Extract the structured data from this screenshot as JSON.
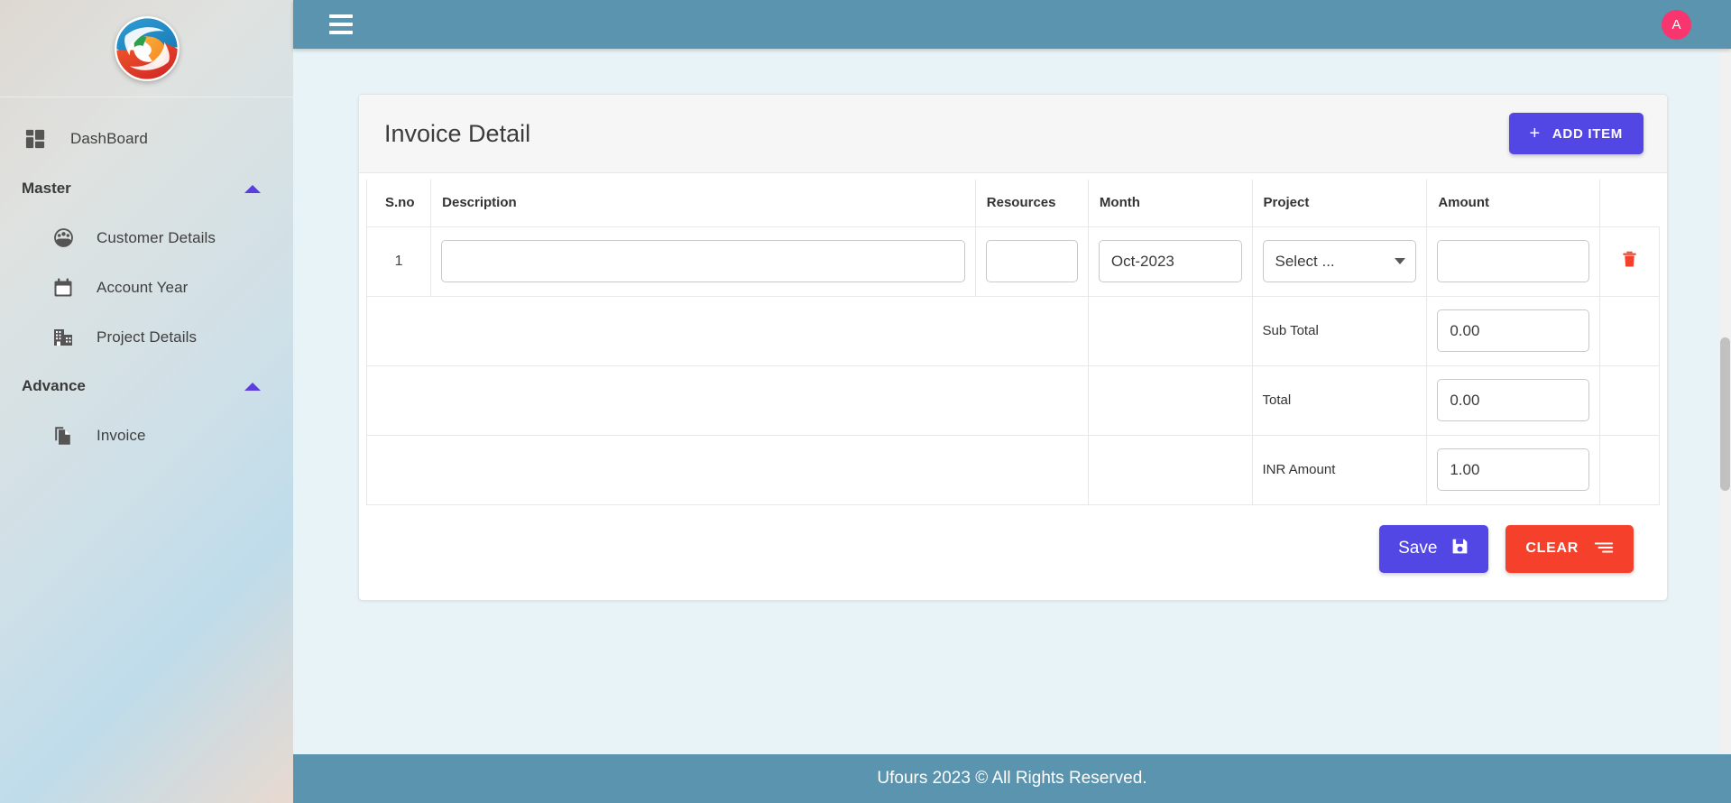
{
  "sidebar": {
    "logo_name": "ufours-logo",
    "dashboard": {
      "label": "DashBoard",
      "icon": "dashboard-grid-icon"
    },
    "groups": [
      {
        "label": "Master",
        "caret": "chevron-up-icon",
        "items": [
          {
            "label": "Customer Details",
            "icon": "people-group-icon"
          },
          {
            "label": "Account Year",
            "icon": "calendar-icon"
          },
          {
            "label": "Project Details",
            "icon": "building-icon"
          }
        ]
      },
      {
        "label": "Advance",
        "caret": "chevron-up-icon",
        "items": [
          {
            "label": "Invoice",
            "icon": "documents-copy-icon"
          }
        ]
      }
    ]
  },
  "topbar": {
    "menu_icon": "hamburger-menu-icon",
    "avatar_initial": "A",
    "avatar_color": "#f8356e",
    "bg_color": "#5a94ae"
  },
  "card": {
    "title": "Invoice Detail",
    "add_item_label": "ADD ITEM",
    "add_item_icon": "plus-icon",
    "add_item_color": "#5246e5"
  },
  "table": {
    "columns": [
      "S.no",
      "Description",
      "Resources",
      "Month",
      "Project",
      "Amount"
    ],
    "rows": [
      {
        "sno": "1",
        "description": "",
        "description_placeholder": "",
        "resources": "",
        "resources_placeholder": "",
        "month": "Oct-2023",
        "project": "Select ...",
        "amount": "",
        "amount_placeholder": "",
        "delete_icon": "trash-icon"
      }
    ],
    "totals": [
      {
        "label": "Sub Total",
        "value": "0.00"
      },
      {
        "label": "Total",
        "value": "0.00"
      },
      {
        "label": "INR Amount",
        "value": "1.00"
      }
    ]
  },
  "actions": {
    "save_label": "Save",
    "save_icon": "save-floppy-icon",
    "save_color": "#5246e5",
    "clear_label": "CLEAR",
    "clear_icon": "lines-icon",
    "clear_color": "#f5402c"
  },
  "footer": {
    "text": "Ufours 2023 © All Rights Reserved.",
    "bg_color": "#5a94ae"
  }
}
